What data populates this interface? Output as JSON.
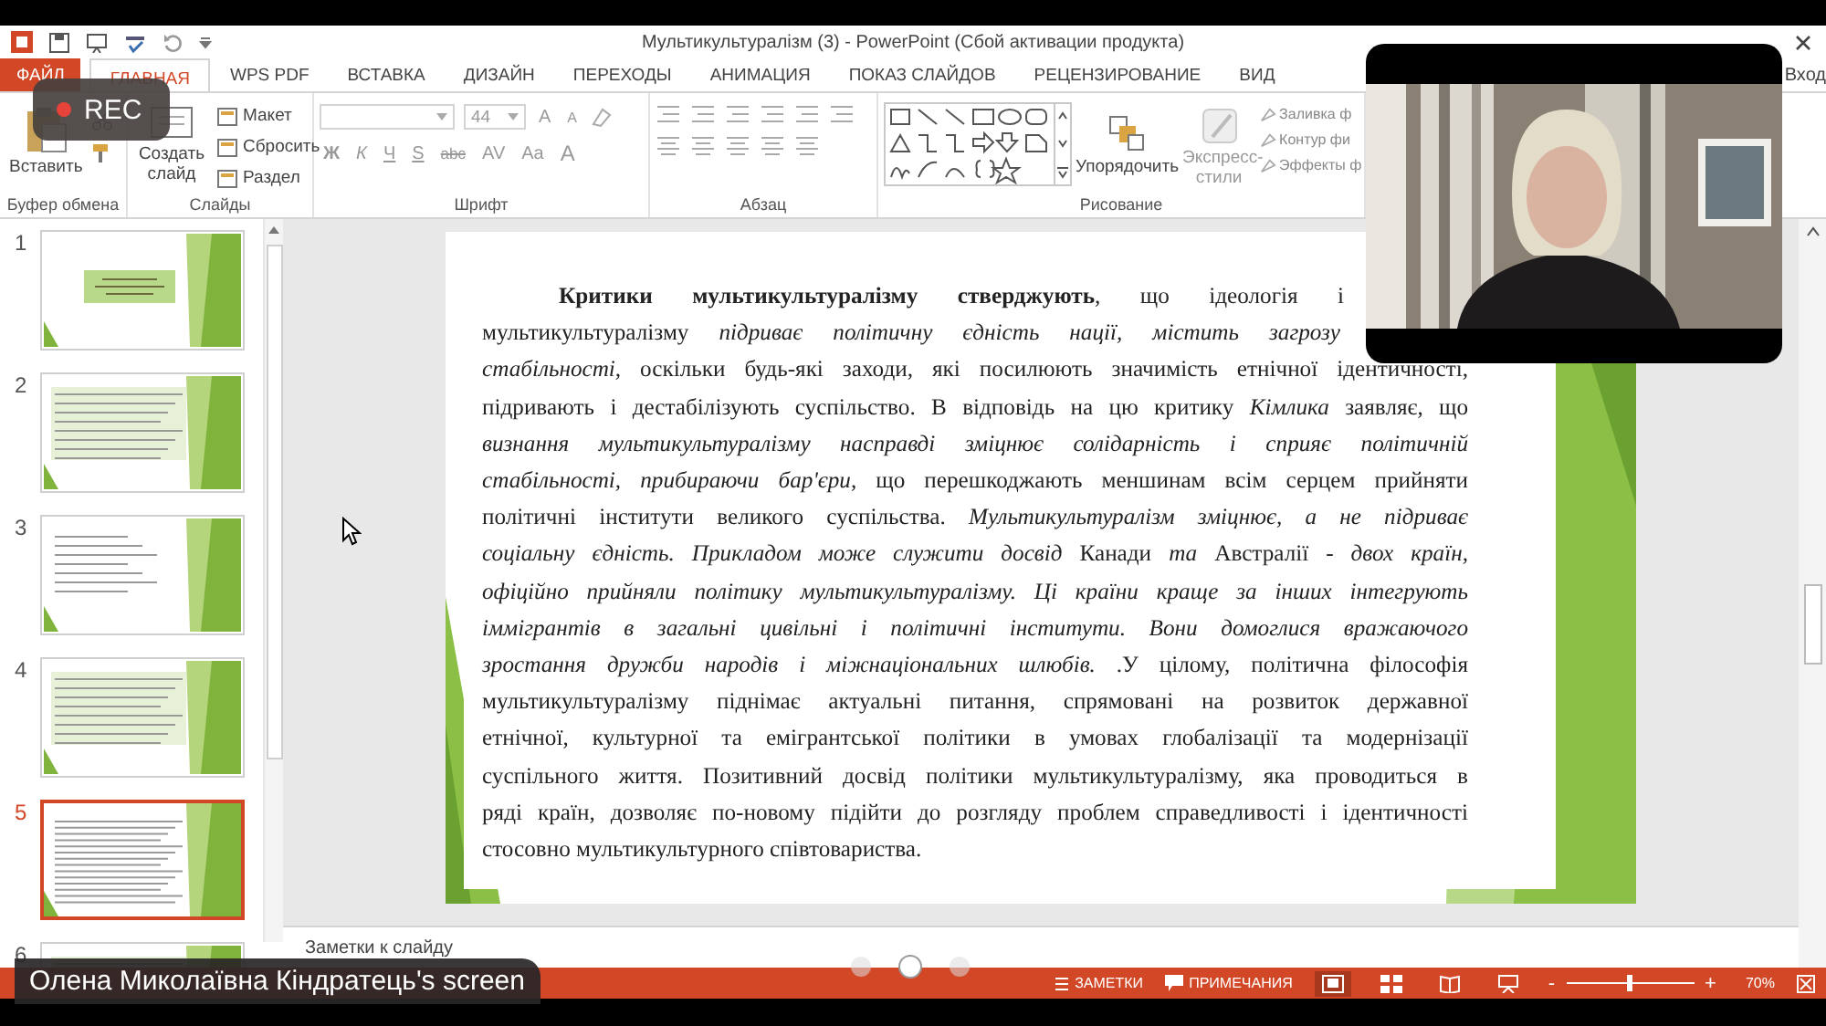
{
  "title_bar": {
    "title": "Мультикультуралізм (3) - PowerPoint (Сбой активации продукта)"
  },
  "recording": {
    "label": "REC"
  },
  "tabs": [
    {
      "label": "ФАЙЛ",
      "kind": "file",
      "selected": false
    },
    {
      "label": "ГЛАВНАЯ",
      "kind": "tab",
      "selected": true
    },
    {
      "label": "WPS PDF",
      "kind": "tab",
      "selected": false
    },
    {
      "label": "ВСТАВКА",
      "kind": "tab",
      "selected": false
    },
    {
      "label": "ДИЗАЙН",
      "kind": "tab",
      "selected": false
    },
    {
      "label": "ПЕРЕХОДЫ",
      "kind": "tab",
      "selected": false
    },
    {
      "label": "АНИМАЦИЯ",
      "kind": "tab",
      "selected": false
    },
    {
      "label": "ПОКАЗ СЛАЙДОВ",
      "kind": "tab",
      "selected": false
    },
    {
      "label": "РЕЦЕНЗИРОВАНИЕ",
      "kind": "tab",
      "selected": false
    },
    {
      "label": "ВИД",
      "kind": "tab",
      "selected": false
    }
  ],
  "account": {
    "label": "Вход"
  },
  "ribbon": {
    "clipboard": {
      "paste": "Вставить",
      "label": "Буфер обмена"
    },
    "slides": {
      "new_slide": "Создать слайд",
      "items": [
        "Макет",
        "Сбросить",
        "Раздел"
      ],
      "label": "Слайды"
    },
    "font": {
      "size": "44",
      "grow": "A",
      "shrink": "A",
      "buttons": [
        "Ж",
        "К",
        "Ч",
        "S",
        "abc",
        "AV",
        "Aa",
        "A"
      ],
      "label": "Шрифт"
    },
    "paragraph": {
      "label": "Абзац"
    },
    "drawing": {
      "arrange": "Упорядочить",
      "quick_styles": "Экспресс-стили",
      "items": [
        "Заливка ф",
        "Контур фи",
        "Эффекты ф"
      ],
      "label": "Рисование"
    }
  },
  "slides_panel": [
    {
      "number": "1",
      "kind": "title",
      "selected": false
    },
    {
      "number": "2",
      "kind": "text",
      "selected": false
    },
    {
      "number": "3",
      "kind": "list",
      "selected": false
    },
    {
      "number": "4",
      "kind": "text",
      "selected": false
    },
    {
      "number": "5",
      "kind": "dense",
      "selected": true
    },
    {
      "number": "6",
      "kind": "text",
      "selected": false
    }
  ],
  "slide": {
    "lines": [
      {
        "kind": "first",
        "italic": false,
        "text": "**Критики мультикультуралізму стверджують**, що ідеологія і"
      },
      {
        "kind": "short",
        "italic": false,
        "text": "мультикультуралізму *підриває політичну єдність нації, містить загрозу*"
      },
      {
        "kind": "body",
        "italic": false,
        "text": "*стабільності,* оскільки будь-які заходи, які посилюють значимість етнічної ідентичності,"
      },
      {
        "kind": "body",
        "italic": false,
        "text": "підривають і дестабілізують суспільство. В відповідь на цю критику *Кімлика* заявляє, що"
      },
      {
        "kind": "body",
        "italic": true,
        "text": "визнання мультикультуралізму насправді зміцнює солідарність і сприяє політичній"
      },
      {
        "kind": "body",
        "italic": false,
        "text": "*стабільності, прибираючи бар'єри*, що перешкоджають меншинам всім серцем прийняти"
      },
      {
        "kind": "body",
        "italic": false,
        "text": "політичні інститути великого суспільства. *Мультикультуралізм зміцнює, а не підриває*"
      },
      {
        "kind": "body",
        "italic": false,
        "text": "*соціальну єдність. Прикладом може служити досвід* Канади *та* Австралії *- двох країн,*"
      },
      {
        "kind": "body",
        "italic": true,
        "text": "офіційно прийняли політику мультикультуралізму. Ці країни краще за інших інтегрують"
      },
      {
        "kind": "body",
        "italic": true,
        "text": "іммігрантів в загальні цивільні і політичні інститути. Вони домоглися вражаючого"
      },
      {
        "kind": "body",
        "italic": false,
        "text": "*зростання дружби народів і міжнаціональних шлюбів.* .У цілому, політична філософія"
      },
      {
        "kind": "body",
        "italic": false,
        "text": "мультикультуралізму піднімає актуальні питання, спрямовані на розвиток державної"
      },
      {
        "kind": "body",
        "italic": false,
        "text": "етнічної, культурної та емігрантської політики в умовах глобалізації та модернізації"
      },
      {
        "kind": "body",
        "italic": false,
        "text": "суспільного життя. Позитивний досвід політики мультикультуралізму, яка проводиться в"
      },
      {
        "kind": "body",
        "italic": false,
        "text": "ряді країн, дозволяє по-новому підійти до розгляду проблем справедливості і ідентичності"
      },
      {
        "kind": "last",
        "italic": false,
        "text": "стосовно мультикультурного співтовариства."
      }
    ]
  },
  "notes": {
    "placeholder": "Заметки к слайду"
  },
  "status_bar": {
    "notes": "ЗАМЕТКИ",
    "comments": "ПРИМЕЧАНИЯ",
    "views": [
      {
        "kind": "normal",
        "selected": true
      },
      {
        "kind": "sorter",
        "selected": false
      },
      {
        "kind": "reading",
        "selected": false
      },
      {
        "kind": "show",
        "selected": false
      }
    ],
    "zoom_out": "-",
    "zoom": {
      "level": 0.48
    },
    "zoom_in": "+",
    "zoom_percent": "70%"
  },
  "pager": [
    {
      "selected": false
    },
    {
      "selected": true
    },
    {
      "selected": false
    }
  ],
  "screen_share": {
    "label": "Олена Миколаївна Кіндратець's screen"
  }
}
